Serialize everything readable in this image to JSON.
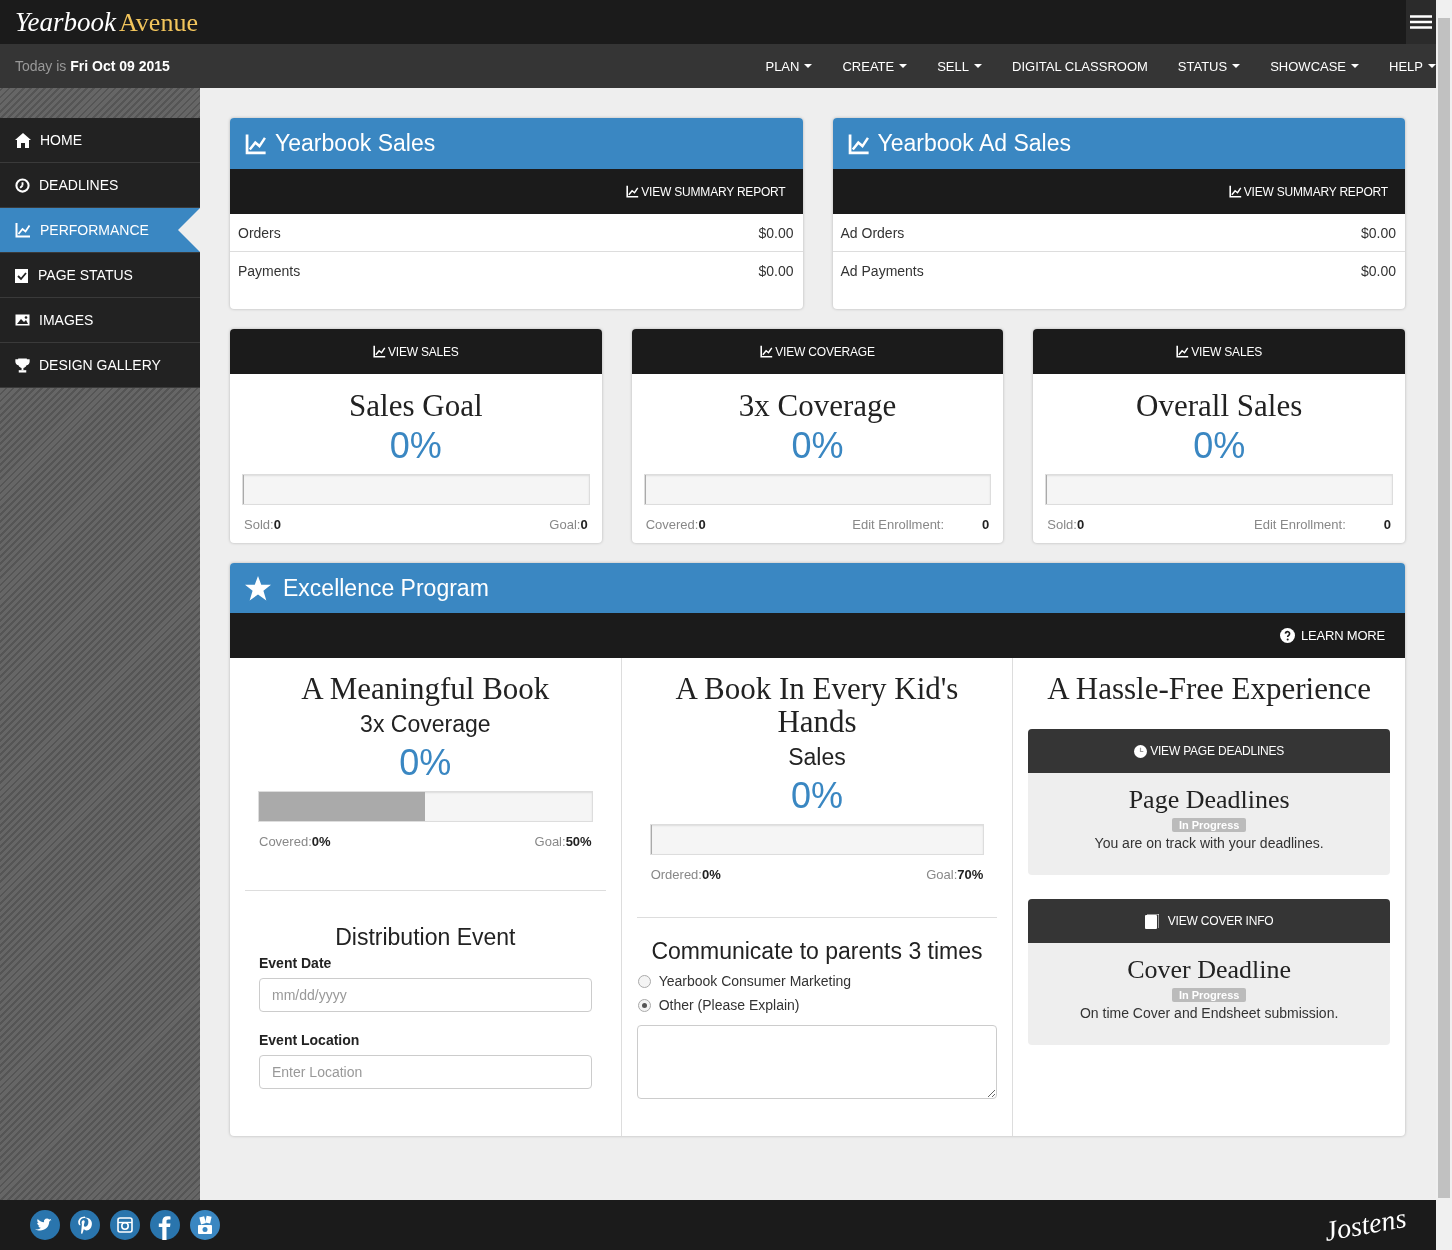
{
  "header": {
    "logo_script": "Yearbook",
    "logo_word": "Avenue"
  },
  "subbar": {
    "date_prefix": "Today is",
    "date": "Fri Oct 09 2015"
  },
  "nav": [
    {
      "label": "PLAN",
      "dropdown": true
    },
    {
      "label": "CREATE",
      "dropdown": true
    },
    {
      "label": "SELL",
      "dropdown": true
    },
    {
      "label": "DIGITAL CLASSROOM",
      "dropdown": false
    },
    {
      "label": "STATUS",
      "dropdown": true
    },
    {
      "label": "SHOWCASE",
      "dropdown": true
    },
    {
      "label": "HELP",
      "dropdown": true
    }
  ],
  "sidebar": {
    "items": [
      {
        "label": "HOME",
        "kind": "home",
        "selected": false
      },
      {
        "label": "DEADLINES",
        "kind": "clock",
        "selected": false
      },
      {
        "label": "PERFORMANCE",
        "kind": "chart",
        "selected": true
      },
      {
        "label": "PAGE STATUS",
        "kind": "page",
        "selected": false
      },
      {
        "label": "IMAGES",
        "kind": "image",
        "selected": false
      },
      {
        "label": "DESIGN GALLERY",
        "kind": "trophy",
        "selected": false
      }
    ]
  },
  "sales_panels": [
    {
      "title": "Yearbook Sales",
      "action": "VIEW SUMMARY REPORT",
      "rows": [
        {
          "label": "Orders",
          "value": "$0.00"
        },
        {
          "label": "Payments",
          "value": "$0.00"
        }
      ]
    },
    {
      "title": "Yearbook Ad Sales",
      "action": "VIEW SUMMARY REPORT",
      "rows": [
        {
          "label": "Ad Orders",
          "value": "$0.00"
        },
        {
          "label": "Ad Payments",
          "value": "$0.00"
        }
      ]
    }
  ],
  "stat_cards": [
    {
      "action": "VIEW SALES",
      "title": "Sales Goal",
      "percent": "0%",
      "level": 0,
      "left_label": "Sold:",
      "left_value": "0",
      "right_label": "Goal:",
      "right_value": "0",
      "right_spaced": false
    },
    {
      "action": "VIEW COVERAGE",
      "title": "3x Coverage",
      "percent": "0%",
      "level": 0,
      "left_label": "Covered:",
      "left_value": "0",
      "right_label": "Edit Enrollment:",
      "right_value": "0",
      "right_spaced": true
    },
    {
      "action": "VIEW SALES",
      "title": "Overall Sales",
      "percent": "0%",
      "level": 0,
      "left_label": "Sold:",
      "left_value": "0",
      "right_label": "Edit Enrollment:",
      "right_value": "0",
      "right_spaced": true
    }
  ],
  "excellence": {
    "title": "Excellence Program",
    "action": "LEARN MORE",
    "meaningful": {
      "title": "A Meaningful Book",
      "subtitle": "3x Coverage",
      "percent": "0%",
      "level": 0.5,
      "left_label": "Covered:",
      "left_value": "0%",
      "right_label": "Goal:",
      "right_value": "50%",
      "event_title": "Distribution Event",
      "fields": [
        {
          "label": "Event Date",
          "placeholder": "mm/dd/yyyy"
        },
        {
          "label": "Event Location",
          "placeholder": "Enter Location"
        }
      ]
    },
    "every_kid": {
      "title": "A Book In Every Kid's Hands",
      "subtitle": "Sales",
      "percent": "0%",
      "level": 0,
      "left_label": "Ordered:",
      "left_value": "0%",
      "right_label": "Goal:",
      "right_value": "70%",
      "communicate_title": "Communicate to parents 3 times",
      "options": [
        {
          "label": "Yearbook Consumer Marketing",
          "selected": false
        },
        {
          "label": "Other (Please Explain)",
          "selected": true
        }
      ]
    },
    "hassle_free": {
      "title": "A Hassle-Free Experience",
      "cards": [
        {
          "kind": "clock",
          "action": "VIEW PAGE DEADLINES",
          "title": "Page Deadlines",
          "badge": "In Progress",
          "text": "You are on track with your deadlines."
        },
        {
          "kind": "book",
          "action": "VIEW COVER INFO",
          "title": "Cover Deadline",
          "badge": "In Progress",
          "text": "On time Cover and Endsheet submission."
        }
      ]
    }
  },
  "footer": {
    "brand": "Jostens"
  }
}
